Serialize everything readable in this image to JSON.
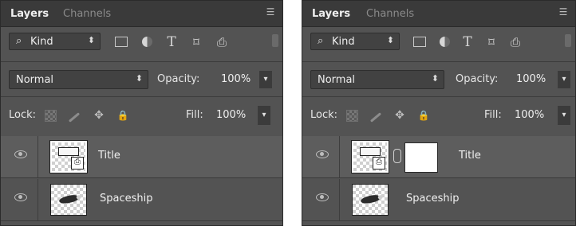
{
  "panels": [
    {
      "tabs": {
        "active": "Layers",
        "inactive": "Channels"
      },
      "filter": {
        "kind_label": "Kind"
      },
      "blend_mode": "Normal",
      "opacity": {
        "label": "Opacity:",
        "value": "100%"
      },
      "lock": {
        "label": "Lock:"
      },
      "fill": {
        "label": "Fill:",
        "value": "100%"
      },
      "layers": [
        {
          "name": "Title",
          "selected": true,
          "has_mask": false
        },
        {
          "name": "Spaceship",
          "selected": false,
          "has_mask": false
        }
      ]
    },
    {
      "tabs": {
        "active": "Layers",
        "inactive": "Channels"
      },
      "filter": {
        "kind_label": "Kind"
      },
      "blend_mode": "Normal",
      "opacity": {
        "label": "Opacity:",
        "value": "100%"
      },
      "lock": {
        "label": "Lock:"
      },
      "fill": {
        "label": "Fill:",
        "value": "100%"
      },
      "layers": [
        {
          "name": "Title",
          "selected": true,
          "has_mask": true
        },
        {
          "name": "Spaceship",
          "selected": false,
          "has_mask": false
        }
      ]
    }
  ],
  "icons": {
    "search": "⌕",
    "chevron_updown": "⬍",
    "chevron_down": "▾",
    "type": "T",
    "shape": "⌑",
    "smart": "⎙",
    "move": "✥",
    "lock": "🔒",
    "menu": "☰"
  },
  "colors": {
    "panel_bg": "#535353",
    "tab_bar": "#3a3a3a",
    "selected_row": "#5d5d5d"
  }
}
